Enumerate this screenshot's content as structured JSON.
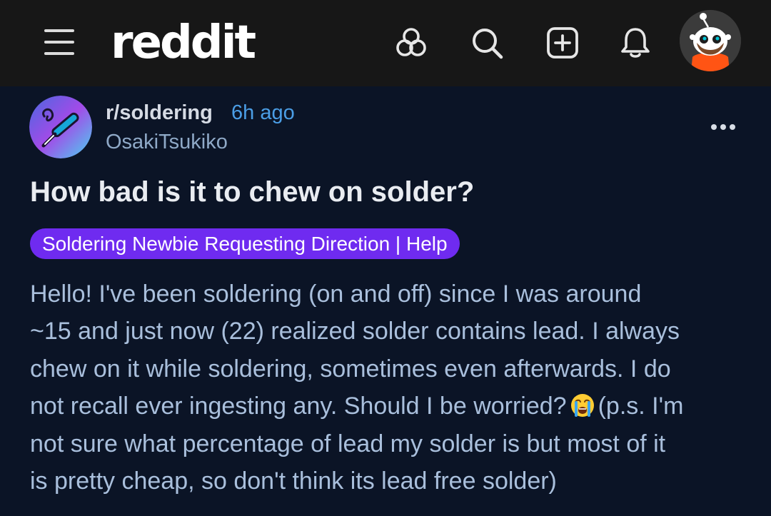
{
  "header": {
    "logo": "reddit",
    "icons": [
      "menu-icon",
      "popular-icon",
      "search-icon",
      "create-post-icon",
      "notifications-icon",
      "user-avatar"
    ]
  },
  "post": {
    "subreddit": "r/soldering",
    "time": "6h ago",
    "author": "OsakiTsukiko",
    "title": "How bad is it to chew on solder?",
    "flair": "Soldering Newbie Requesting Direction | Help",
    "body_lines": [
      "Hello! I've been soldering (on and off) since I was around",
      "~15 and just now (22) realized solder contains lead. I always",
      "chew on it while soldering, sometimes even afterwards. I do",
      "not recall ever ingesting any. Should I be worried?",
      "(p.s. I'm",
      "not sure what percentage of lead my solder is but most of it",
      "is pretty cheap, so don't think its lead free solder)"
    ],
    "emoji": "loudly-crying-face"
  },
  "colors": {
    "topbar": "#171717",
    "background": "#0b1426",
    "flair": "#6f2bf0",
    "time": "#4b9ee6",
    "body_text": "#a9bfdc"
  }
}
